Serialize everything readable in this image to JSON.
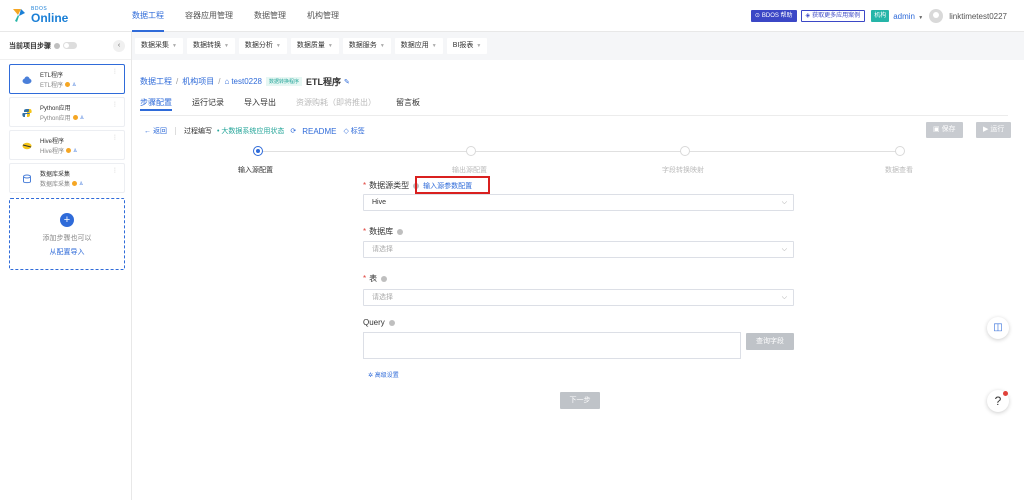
{
  "logo": {
    "small": "BDOS",
    "big": "Online"
  },
  "top_nav": [
    "数据工程",
    "容器应用管理",
    "数据管理",
    "机构管理"
  ],
  "header_right": {
    "help_label": "BDOS 帮助",
    "cases_label": "获取更多应用案例",
    "org_tag": "机构",
    "user": "admin",
    "account": "linktimetest0227"
  },
  "sidebar": {
    "title": "当前项目步骤",
    "collapse": "‹",
    "steps": [
      {
        "title": "ETL程序",
        "sub": "ETL程序"
      },
      {
        "title": "Python应用",
        "sub": "Python应用"
      },
      {
        "title": "Hive程序",
        "sub": "Hive程序"
      },
      {
        "title": "数据库采集",
        "sub": "数据库采集"
      }
    ],
    "add": {
      "line1": "添加步骤也可以",
      "line2": "从配置导入"
    }
  },
  "toolbar": [
    "数据采集",
    "数据转换",
    "数据分析",
    "数据质量",
    "数据服务",
    "数据应用",
    "BI报表"
  ],
  "breadcrumb": {
    "items": [
      "数据工程",
      "机构项目"
    ],
    "project": "test0228",
    "tag": "数据转换程序",
    "current": "ETL程序"
  },
  "tabs": [
    "步骤配置",
    "运行记录",
    "导入导出",
    "资源购耗（即将推出）",
    "留言板"
  ],
  "subbar": {
    "back": "返回",
    "process": "过程编写",
    "state": "大数据系统应用状态",
    "readme": "README",
    "tag": "标签",
    "save": "保存",
    "run": "运行"
  },
  "wizard_steps": [
    "输入源配置",
    "输出源配置",
    "字段转换映射",
    "数据查看"
  ],
  "form": {
    "source_type_label": "数据源类型",
    "config_link": "输入源参数配置",
    "source_type_value": "Hive",
    "db_label": "数据库",
    "db_placeholder": "请选择",
    "table_label": "表",
    "table_placeholder": "请选择",
    "query_label": "Query",
    "query_button": "查询字段",
    "advanced": "高级设置",
    "next": "下一步"
  }
}
